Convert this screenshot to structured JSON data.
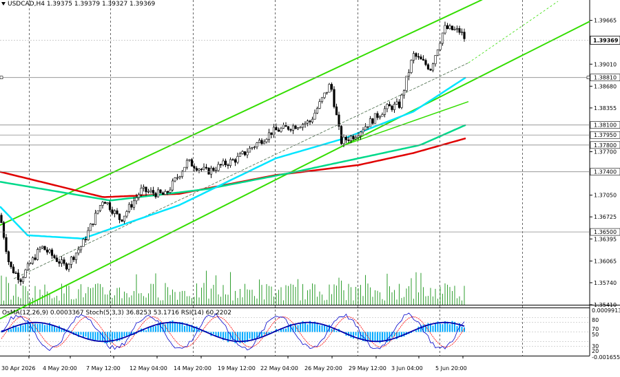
{
  "header": {
    "symbol_line": "USDCAD,H4  1.39375 1.39379 1.39327 1.39369"
  },
  "indicator_header": "OsMA(12,26,9) 0.0003367  Stoch(5,3,3) 36.8253 53.1716  RSI(14) 60.2202",
  "colors": {
    "background": "#ffffff",
    "candle": "#000000",
    "volume": "#2e9e2e",
    "ema_fast": "#00e5ff",
    "ema_mid": "#00d98a",
    "ema_slow": "#e00000",
    "channel": "#33dd00",
    "grid": "#000000",
    "histogram": "#00aaff",
    "stoch_main": "#0000cc",
    "stoch_signal": "#ff0000"
  },
  "chart_data": {
    "type": "candlestick",
    "symbol": "USDCAD",
    "timeframe": "H4",
    "ylim": [
      1.3541,
      1.3997
    ],
    "price_ticks": [
      1.39665,
      1.3901,
      1.3868,
      1.38355,
      1.377,
      1.3705,
      1.36725,
      1.36395,
      1.36065,
      1.3574,
      1.3541
    ],
    "price_tick_labels": [
      "1.39665",
      "1.39010",
      "1.38680",
      "1.38355",
      "1.37700",
      "1.37050",
      "1.36725",
      "1.36395",
      "1.36065",
      "1.35740",
      "1.35410"
    ],
    "levels": [
      {
        "value": 1.3881,
        "label": "1.38810"
      },
      {
        "value": 1.381,
        "label": "1.38100"
      },
      {
        "value": 1.3795,
        "label": "1.37950"
      },
      {
        "value": 1.378,
        "label": "1.37800"
      },
      {
        "value": 1.374,
        "label": "1.37400"
      },
      {
        "value": 1.365,
        "label": "1.36500"
      }
    ],
    "current_price": {
      "value": 1.39369,
      "label": "1.39369"
    },
    "x_tick_labels": [
      "30 Apr 2026",
      "4 May 20:00",
      "7 May 12:00",
      "12 May 04:00",
      "14 May 20:00",
      "19 May 12:00",
      "22 May 04:00",
      "26 May 20:00",
      "29 May 12:00",
      "3 Jun 04:00",
      "5 Jun 20:00"
    ],
    "osc_tick_labels": [
      "0.0009913",
      "80",
      "70",
      "50",
      "30",
      "20",
      "-0.0016556"
    ],
    "osc_values": {
      "macd_top": 0.0009913,
      "macd_bottom": -0.0016556
    },
    "ema_levels": {
      "ema_fast_last": 1.3881,
      "ema_mid_last": 1.381,
      "ema_slow_last": 1.3795
    }
  }
}
